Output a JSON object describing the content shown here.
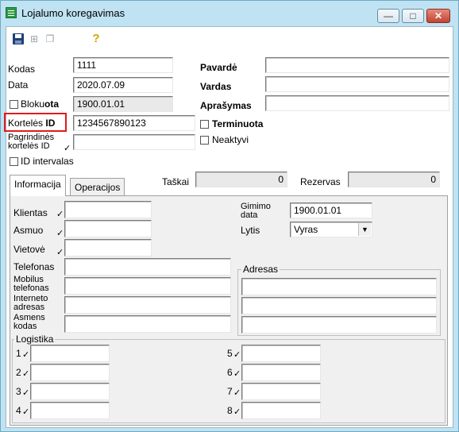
{
  "window": {
    "title": "Lojalumo koregavimas",
    "minimize_glyph": "—",
    "maximize_glyph": "□",
    "close_glyph": "✕"
  },
  "toolbar": {
    "icons": [
      "save-icon",
      "tree-icon",
      "copy-icon",
      "key-icon"
    ],
    "key_glyph": "?"
  },
  "form": {
    "kodas_label": "Kodas",
    "kodas_value": "1111",
    "data_label": "Data",
    "data_value": "2020.07.09",
    "blokuota_label_pre": "Bloku",
    "blokuota_label_bold": "ota",
    "blokuota_value": "1900.01.01",
    "korteles_id_label": "Kortelės ID",
    "korteles_id_value": "1234567890123",
    "pagrindines_label_1": "Pagrindinės",
    "pagrindines_label_2": "kortelės ID",
    "id_intervalas_label": "ID intervalas",
    "pavarde_label": "Pavardė",
    "vardas_label": "Vardas",
    "aprasymas_label": "Aprašymas",
    "terminuota_label": "Terminuota",
    "neaktyvi_label": "Neaktyvi",
    "taskai_label": "Taškai",
    "taskai_value": "0",
    "rezervas_label": "Rezervas",
    "rezervas_value": "0"
  },
  "tabs": [
    {
      "label": "Informacija",
      "active": true
    },
    {
      "label": "Operacijos",
      "active": false
    }
  ],
  "info": {
    "klientas_label": "Klientas",
    "asmuo_label": "Asmuo",
    "vietove_label": "Vietovė",
    "telefonas_label": "Telefonas",
    "mobilus_1": "Mobilus",
    "mobilus_2": "telefonas",
    "internetas_1": "Interneto",
    "internetas_2": "adresas",
    "asmens_1": "Asmens",
    "asmens_2": "kodas",
    "gimimo_1": "Gimimo",
    "gimimo_2": "data",
    "gimimo_value": "1900.01.01",
    "lytis_label": "Lytis",
    "lytis_value": "Vyras",
    "adresas_label": "Adresas",
    "logistika_label": "Logistika",
    "logistika_numbers": [
      "1",
      "2",
      "3",
      "4",
      "5",
      "6",
      "7",
      "8"
    ]
  },
  "tick_glyph": "✓"
}
